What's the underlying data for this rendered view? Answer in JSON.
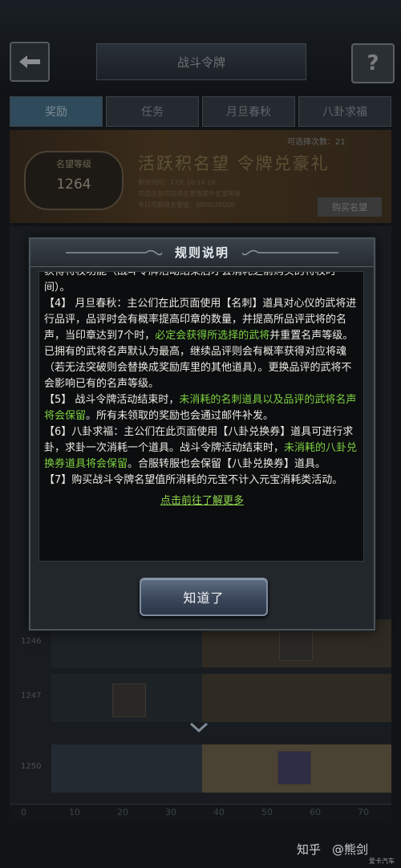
{
  "header": {
    "title": "战斗令牌",
    "help_label": "?"
  },
  "tabs": [
    {
      "label": "奖励"
    },
    {
      "label": "任务"
    },
    {
      "label": "月旦春秋"
    },
    {
      "label": "八卦求福"
    }
  ],
  "banner": {
    "fame_label": "名望等级",
    "fame_value": "1264",
    "slogan": "活跃积名望 令牌兑豪礼",
    "count_text": "可选择次数：21",
    "line1": "剩余时间：17天 16:14:16",
    "line2": "完成任务可获得名望值提升名望等级",
    "line3": "今日可获得名望值：9800/20000",
    "buy_label": "购买名望"
  },
  "rows": [
    {
      "level": "1246"
    },
    {
      "level": "1247"
    },
    {
      "level": "1250"
    }
  ],
  "progress_ticks": [
    "0",
    "10",
    "20",
    "30",
    "40",
    "50",
    "60",
    "70"
  ],
  "dialog": {
    "title": "规则说明",
    "paragraphs": [
      [
        {
          "t": "获得特权功能（战斗令牌活动结束后才会消耗之前购买的特权时间）。",
          "g": false
        }
      ],
      [
        {
          "t": "【4】 月旦春秋：主公们在此页面使用【名刺】道具对心仪的武将进行品评，品评时会有概率提高印章的数量，并提高所品评武将的名声，当印章达到7个时，",
          "g": false
        },
        {
          "t": "必定会获得所选择的武将",
          "g": true
        },
        {
          "t": "并重置名声等级。已拥有的武将名声默认为最高，继续品评则会有概率获得对应将魂（若无法突破则会替换成奖励库里的其他道具）。更换品评的武将不会影响已有的名声等级。",
          "g": false
        }
      ],
      [
        {
          "t": "【5】 战斗令牌活动结束时，",
          "g": false
        },
        {
          "t": "未消耗的名刺道具以及品评的武将名声将会保留",
          "g": true
        },
        {
          "t": "。所有未领取的奖励也会通过邮件补发。",
          "g": false
        }
      ],
      [
        {
          "t": "【6】八卦求福：主公们在此页面使用【八卦兑换券】道具可进行求卦，求卦一次消耗一个道具。战斗令牌活动结束时，",
          "g": false
        },
        {
          "t": "未消耗的八卦兑换券道具将会保留",
          "g": true
        },
        {
          "t": "。合服转服也会保留【八卦兑换券】道具。",
          "g": false
        }
      ],
      [
        {
          "t": "【7】购买战斗令牌名望值所消耗的元宝不计入元宝消耗类活动。",
          "g": false
        }
      ]
    ],
    "more_link": "点击前往了解更多",
    "ok_label": "知道了"
  },
  "watermark": {
    "site": "知乎",
    "author": "@熊剑",
    "sub": "爱卡汽车"
  }
}
